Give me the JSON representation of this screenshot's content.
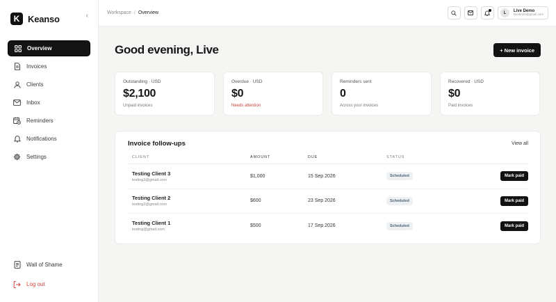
{
  "brand": {
    "name": "Keanso",
    "logo_letter": "K"
  },
  "sidebar": {
    "collapse_icon": "chevron-left-icon",
    "items": [
      {
        "label": "Overview",
        "icon": "grid-icon",
        "active": true
      },
      {
        "label": "Invoices",
        "icon": "file-icon"
      },
      {
        "label": "Clients",
        "icon": "user-icon"
      },
      {
        "label": "Inbox",
        "icon": "mail-icon"
      },
      {
        "label": "Reminders",
        "icon": "calendar-clock-icon"
      },
      {
        "label": "Notifications",
        "icon": "bell-icon"
      },
      {
        "label": "Settings",
        "icon": "gear-icon"
      }
    ],
    "bottom": [
      {
        "label": "Wall of Shame",
        "icon": "document-icon"
      },
      {
        "label": "Log out",
        "icon": "logout-icon"
      }
    ]
  },
  "topbar": {
    "breadcrumb": {
      "root": "Workspace",
      "separator": "/",
      "current": "Overview"
    },
    "user": {
      "initial": "L",
      "name": "Live Demo",
      "email": "livedemo@gmail.com"
    }
  },
  "main": {
    "greeting": "Good evening, Live",
    "new_invoice_label": "+ New invoice",
    "stats": [
      {
        "label": "Outstanding · USD",
        "value": "$2,100",
        "sub": "Unpaid invoices",
        "alert": false
      },
      {
        "label": "Overdue · USD",
        "value": "$0",
        "sub": "Needs attention",
        "alert": true
      },
      {
        "label": "Reminders sent",
        "value": "0",
        "sub": "Across your invoices",
        "alert": false
      },
      {
        "label": "Recovered · USD",
        "value": "$0",
        "sub": "Paid invoices",
        "alert": false
      }
    ],
    "followups": {
      "title": "Invoice follow-ups",
      "view_all": "View all",
      "columns": [
        "CLIENT",
        "AMOUNT",
        "DUE",
        "STATUS"
      ],
      "rows": [
        {
          "client": "Testing Client 3",
          "email": "testing3@gmail.com",
          "amount": "$1,000",
          "due": "15 Sep 2026",
          "status": "Scheduled",
          "action": "Mark paid"
        },
        {
          "client": "Testing Client 2",
          "email": "testing2@gmail.com",
          "amount": "$600",
          "due": "23 Sep 2026",
          "status": "Scheduled",
          "action": "Mark paid"
        },
        {
          "client": "Testing Client 1",
          "email": "testing@gmail.com",
          "amount": "$500",
          "due": "17 Sep 2026",
          "status": "Scheduled",
          "action": "Mark paid"
        }
      ]
    }
  },
  "colors": {
    "accent": "#131313",
    "alert": "#c8433d",
    "badge_bg": "#eef1f4",
    "badge_text": "#4c6378",
    "background": "#f5f5f3"
  }
}
